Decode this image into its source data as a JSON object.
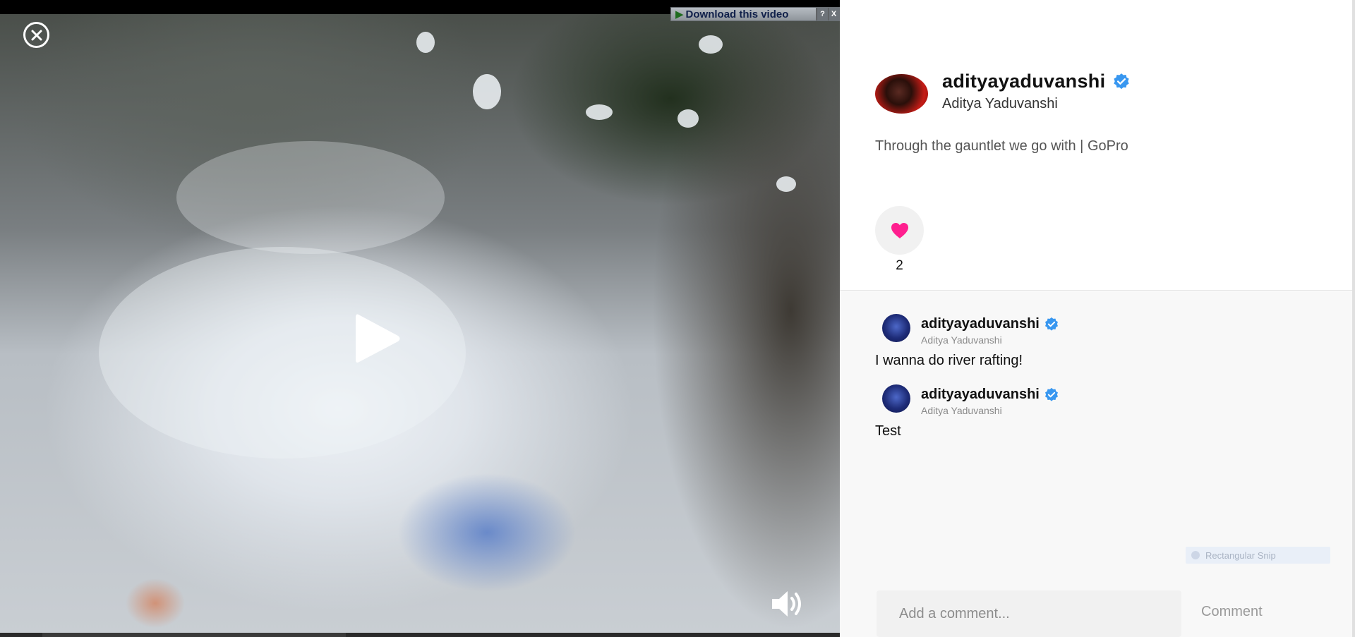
{
  "video": {
    "download_label": "Download this video",
    "download_help": "?",
    "download_close": "X"
  },
  "post": {
    "username": "adityayaduvanshi",
    "full_name": "Aditya Yaduvanshi",
    "caption": "Through the gauntlet we go with | GoPro",
    "like_count": "2",
    "verified": true
  },
  "comments": [
    {
      "username": "adityayaduvanshi",
      "full_name": "Aditya Yaduvanshi",
      "text": "I wanna do river rafting!",
      "verified": true
    },
    {
      "username": "adityayaduvanshi",
      "full_name": "Aditya Yaduvanshi",
      "text": "Test",
      "verified": true
    }
  ],
  "snip_overlay": {
    "label": "Rectangular Snip"
  },
  "comment_form": {
    "placeholder": "Add a comment...",
    "submit_label": "Comment"
  },
  "colors": {
    "heart": "#ff1f8f",
    "verified": "#3897f0"
  },
  "icons": [
    "close-icon",
    "play-icon",
    "volume-icon",
    "heart-icon",
    "verified-icon"
  ]
}
